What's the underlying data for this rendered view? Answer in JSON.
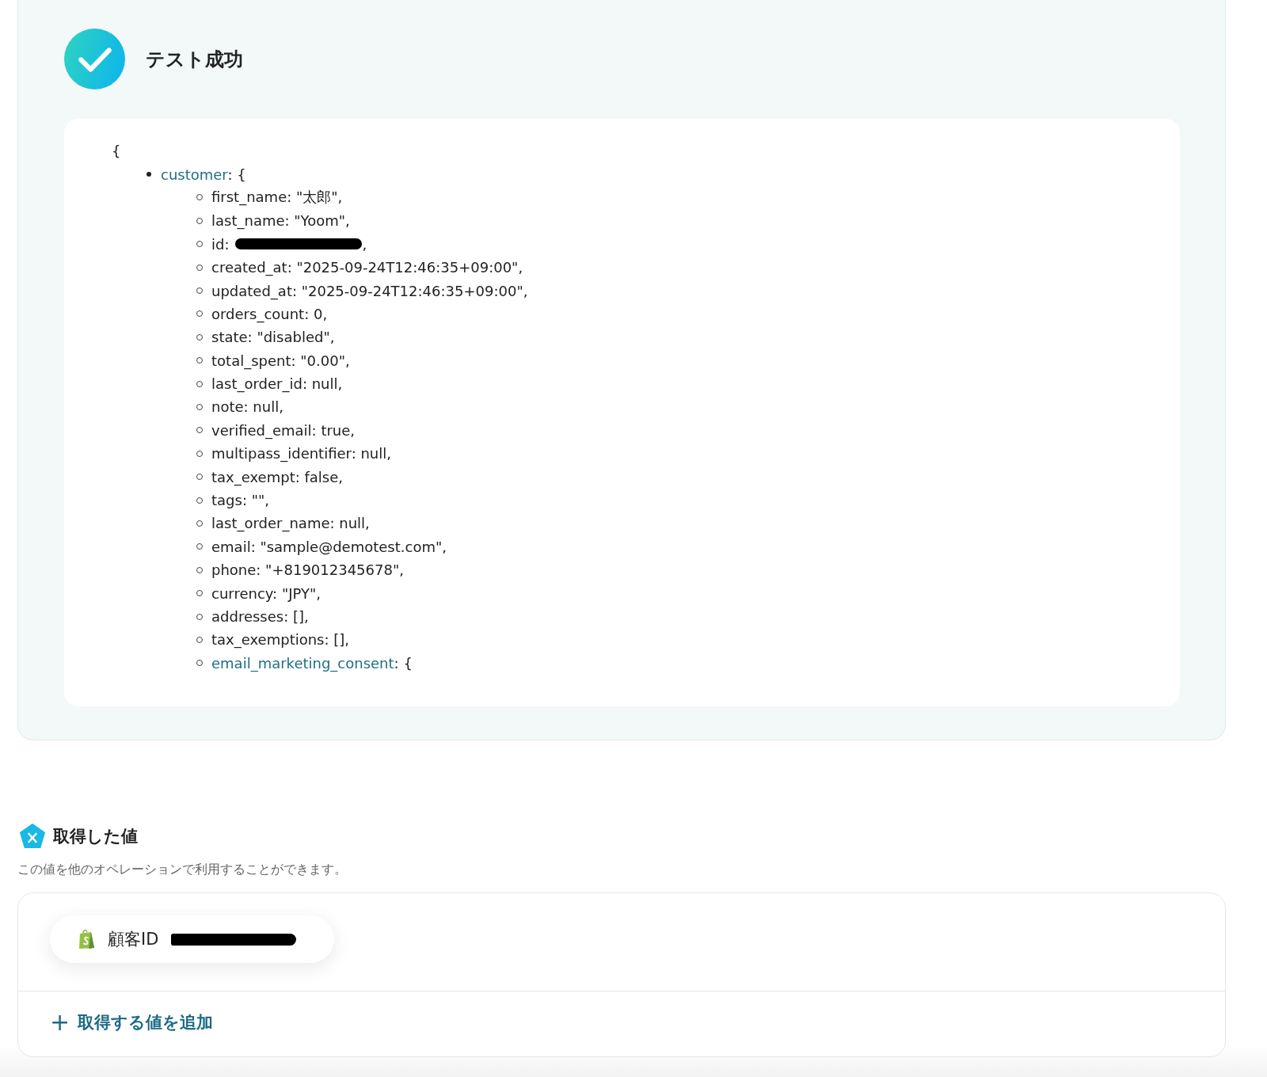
{
  "test_result": {
    "success": true,
    "title": "テスト成功"
  },
  "json_view": {
    "open_brace": "{",
    "root": {
      "key": "customer",
      "rest": ": {",
      "items": [
        {
          "kind": "field",
          "text": "first_name: \"太郎\","
        },
        {
          "kind": "field",
          "text": "last_name: \"Yoom\","
        },
        {
          "kind": "redacted",
          "text": "id:",
          "after": ","
        },
        {
          "kind": "field",
          "text": "created_at: \"2025-09-24T12:46:35+09:00\","
        },
        {
          "kind": "field",
          "text": "updated_at: \"2025-09-24T12:46:35+09:00\","
        },
        {
          "kind": "field",
          "text": "orders_count: 0,"
        },
        {
          "kind": "field",
          "text": "state: \"disabled\","
        },
        {
          "kind": "field",
          "text": "total_spent: \"0.00\","
        },
        {
          "kind": "field",
          "text": "last_order_id: null,"
        },
        {
          "kind": "field",
          "text": "note: null,"
        },
        {
          "kind": "field",
          "text": "verified_email: true,"
        },
        {
          "kind": "field",
          "text": "multipass_identifier: null,"
        },
        {
          "kind": "field",
          "text": "tax_exempt: false,"
        },
        {
          "kind": "field",
          "text": "tags: \"\","
        },
        {
          "kind": "field",
          "text": "last_order_name: null,"
        },
        {
          "kind": "field",
          "text": "email: \"sample@demotest.com\","
        },
        {
          "kind": "field",
          "text": "phone: \"+819012345678\","
        },
        {
          "kind": "field",
          "text": "currency: \"JPY\","
        },
        {
          "kind": "field",
          "text": "addresses: [],"
        },
        {
          "kind": "field",
          "text": "tax_exemptions: [],"
        },
        {
          "kind": "object",
          "text": "email_marketing_consent",
          "after": ": {"
        }
      ]
    }
  },
  "acquired_values": {
    "title": "取得した値",
    "description": "この値を他のオペレーションで利用することができます。",
    "values": [
      {
        "label": "顧客ID",
        "redacted": true
      }
    ],
    "add_button": {
      "icon": "+",
      "label": "取得する値を追加"
    }
  }
}
